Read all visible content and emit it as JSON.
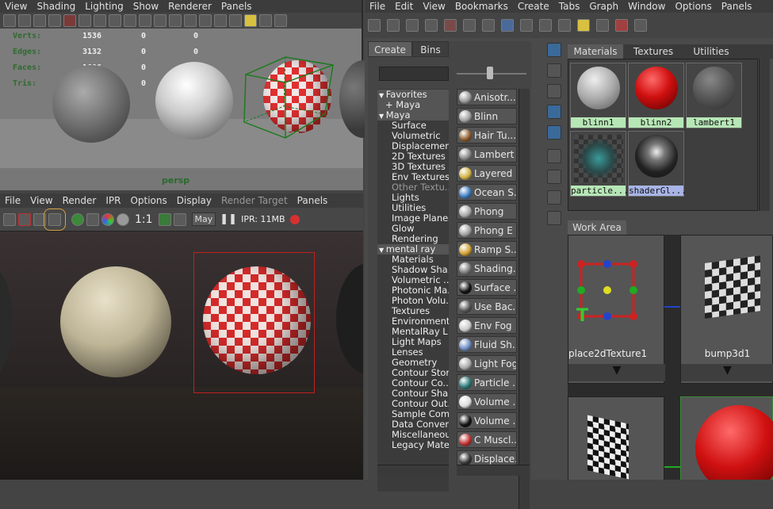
{
  "persp": {
    "menu": [
      "View",
      "Shading",
      "Lighting",
      "Show",
      "Renderer",
      "Panels"
    ],
    "hud": [
      {
        "label": "Verts:",
        "a": "1536",
        "b": "0",
        "c": "0"
      },
      {
        "label": "Edges:",
        "a": "3132",
        "b": "0",
        "c": "0"
      },
      {
        "label": "Faces:",
        "a": "1606",
        "b": "0",
        "c": "0"
      },
      {
        "label": "Tris:",
        "a": "3052",
        "b": "0",
        "c": "0"
      }
    ],
    "camera": "persp"
  },
  "render_view": {
    "menu": [
      "File",
      "View",
      "Render",
      "IPR",
      "Options",
      "Display",
      "Render Target",
      "Panels"
    ],
    "ratio": "1:1",
    "layer": "May",
    "ipr": "IPR: 11MB"
  },
  "hypershade": {
    "menu": [
      "File",
      "Edit",
      "View",
      "Bookmarks",
      "Create",
      "Tabs",
      "Graph",
      "Window",
      "Options",
      "Panels"
    ],
    "left_tabs": [
      "Create",
      "Bins"
    ],
    "tree": [
      {
        "text": "Favorites",
        "level": 0,
        "arrow": "▼",
        "hl": true
      },
      {
        "text": "+ Maya",
        "level": 1,
        "hl": true
      },
      {
        "text": "Maya",
        "level": 0,
        "arrow": "▼",
        "hl": true
      },
      {
        "text": "Surface",
        "level": 2
      },
      {
        "text": "Volumetric",
        "level": 2
      },
      {
        "text": "Displacement",
        "level": 2
      },
      {
        "text": "2D Textures",
        "level": 2
      },
      {
        "text": "3D Textures",
        "level": 2
      },
      {
        "text": "Env Textures",
        "level": 2
      },
      {
        "text": "Other Textu...",
        "level": 2,
        "dim": true
      },
      {
        "text": "Lights",
        "level": 2
      },
      {
        "text": "Utilities",
        "level": 2
      },
      {
        "text": "Image Planes",
        "level": 2
      },
      {
        "text": "Glow",
        "level": 2
      },
      {
        "text": "Rendering",
        "level": 2
      },
      {
        "text": "mental ray",
        "level": 0,
        "arrow": "▼",
        "hl": true
      },
      {
        "text": "Materials",
        "level": 2
      },
      {
        "text": "Shadow Sha...",
        "level": 2
      },
      {
        "text": "Volumetric ...",
        "level": 2
      },
      {
        "text": "Photonic Ma...",
        "level": 2
      },
      {
        "text": "Photon Volu...",
        "level": 2
      },
      {
        "text": "Textures",
        "level": 2
      },
      {
        "text": "Environments",
        "level": 2
      },
      {
        "text": "MentalRay L...",
        "level": 2
      },
      {
        "text": "Light Maps",
        "level": 2
      },
      {
        "text": "Lenses",
        "level": 2
      },
      {
        "text": "Geometry",
        "level": 2
      },
      {
        "text": "Contour Store",
        "level": 2
      },
      {
        "text": "Contour Co...",
        "level": 2
      },
      {
        "text": "Contour Sha...",
        "level": 2
      },
      {
        "text": "Contour Out...",
        "level": 2
      },
      {
        "text": "Sample Com...",
        "level": 2
      },
      {
        "text": "Data Conver...",
        "level": 2
      },
      {
        "text": "Miscellaneous",
        "level": 2
      },
      {
        "text": "Legacy Mate...",
        "level": 2
      }
    ],
    "nodes": [
      {
        "label": "Anisotr...",
        "color": "#9a9a9a"
      },
      {
        "label": "Blinn",
        "color": "#a0a0a0"
      },
      {
        "label": "Hair Tu...",
        "color": "#8a5a2a"
      },
      {
        "label": "Lambert",
        "color": "#888888"
      },
      {
        "label": "Layered ...",
        "color": "#d0b040"
      },
      {
        "label": "Ocean S...",
        "color": "#3a7ac0"
      },
      {
        "label": "Phong",
        "color": "#a8a8a8"
      },
      {
        "label": "Phong E",
        "color": "#a0a0a0"
      },
      {
        "label": "Ramp S...",
        "color": "#d0a030"
      },
      {
        "label": "Shading...",
        "color": "#777777"
      },
      {
        "label": "Surface ...",
        "color": "#111111"
      },
      {
        "label": "Use Bac...",
        "color": "#555555"
      },
      {
        "label": "Env Fog",
        "color": "#cccccc"
      },
      {
        "label": "Fluid Sh...",
        "color": "#6a8ac0"
      },
      {
        "label": "Light Fog",
        "color": "#aaaaaa"
      },
      {
        "label": "Particle ...",
        "color": "#2a7a7a"
      },
      {
        "label": "Volume ...",
        "color": "#dddddd"
      },
      {
        "label": "Volume ...",
        "color": "#111111"
      },
      {
        "label": "C Muscl...",
        "color": "#c03030"
      },
      {
        "label": "Displace...",
        "color": "#333333"
      }
    ],
    "top_tabs": [
      "Materials",
      "Textures",
      "Utilities"
    ],
    "materials": [
      {
        "name": "blinn1"
      },
      {
        "name": "blinn2"
      },
      {
        "name": "lambert1"
      },
      {
        "name": "particle..."
      },
      {
        "name": "shaderGl..."
      }
    ],
    "work_area": {
      "tab": "Work Area",
      "node1": "place2dTexture1",
      "node2": "bump3d1"
    }
  }
}
